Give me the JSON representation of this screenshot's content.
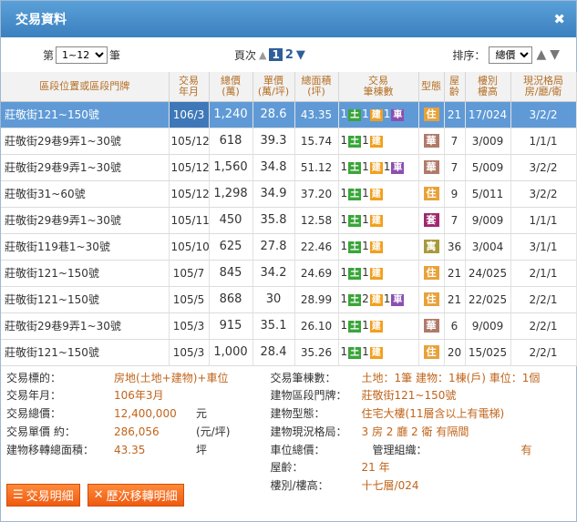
{
  "window": {
    "title": "交易資料",
    "close_glyph": "✖"
  },
  "toolbar": {
    "range_prefix": "第",
    "range_value": "1~12",
    "range_suffix": "筆",
    "page_label": "頁次",
    "current_page": "1",
    "next_page": "2",
    "sort_label": "排序：",
    "sort_value": "總價"
  },
  "table": {
    "headers": [
      "區段位置或區段門牌",
      "交易\n年月",
      "總價\n(萬)",
      "單價\n(萬/坪)",
      "總面積\n(坪)",
      "交易\n筆棟數",
      "型態",
      "屋\n齡",
      "樓別\n樓高",
      "現況格局\n房/廳/衛"
    ],
    "rows": [
      {
        "addr": "莊敬街121~150號",
        "date": "106/3",
        "total": "1,240",
        "unit": "28.6",
        "area": "43.35",
        "land": "1",
        "bld_n": "1",
        "car_n": "1",
        "has_car": true,
        "type": "住",
        "type_color": "zhu",
        "age": "21",
        "floor": "17/024",
        "layout": "3/2/2",
        "selected": true
      },
      {
        "addr": "莊敬街29巷9弄1~30號",
        "date": "105/12",
        "total": "618",
        "unit": "39.3",
        "area": "15.74",
        "land": "1",
        "bld_n": "1",
        "car_n": "",
        "has_car": false,
        "type": "華",
        "type_color": "hua",
        "age": "7",
        "floor": "3/009",
        "layout": "1/1/1"
      },
      {
        "addr": "莊敬街29巷9弄1~30號",
        "date": "105/12",
        "total": "1,560",
        "unit": "34.8",
        "area": "51.12",
        "land": "1",
        "bld_n": "1",
        "car_n": "1",
        "has_car": true,
        "type": "華",
        "type_color": "hua",
        "age": "7",
        "floor": "5/009",
        "layout": "3/2/2"
      },
      {
        "addr": "莊敬街31~60號",
        "date": "105/12",
        "total": "1,298",
        "unit": "34.9",
        "area": "37.20",
        "land": "1",
        "bld_n": "1",
        "car_n": "",
        "has_car": false,
        "type": "住",
        "type_color": "zhu",
        "age": "9",
        "floor": "5/011",
        "layout": "3/2/2"
      },
      {
        "addr": "莊敬街29巷9弄1~30號",
        "date": "105/11",
        "total": "450",
        "unit": "35.8",
        "area": "12.58",
        "land": "1",
        "bld_n": "1",
        "car_n": "",
        "has_car": false,
        "type": "套",
        "type_color": "tao",
        "age": "7",
        "floor": "9/009",
        "layout": "1/1/1"
      },
      {
        "addr": "莊敬街119巷1~30號",
        "date": "105/10",
        "total": "625",
        "unit": "27.8",
        "area": "22.46",
        "land": "1",
        "bld_n": "1",
        "car_n": "",
        "has_car": false,
        "type": "寓",
        "type_color": "yu",
        "age": "36",
        "floor": "3/004",
        "layout": "3/1/1"
      },
      {
        "addr": "莊敬街121~150號",
        "date": "105/7",
        "total": "845",
        "unit": "34.2",
        "area": "24.69",
        "land": "1",
        "bld_n": "1",
        "car_n": "",
        "has_car": false,
        "type": "住",
        "type_color": "zhu",
        "age": "21",
        "floor": "24/025",
        "layout": "2/1/1"
      },
      {
        "addr": "莊敬街121~150號",
        "date": "105/5",
        "total": "868",
        "unit": "30",
        "area": "28.99",
        "land": "1",
        "bld_n": "2",
        "car_n": "1",
        "has_car": true,
        "type": "住",
        "type_color": "zhu",
        "age": "21",
        "floor": "22/025",
        "layout": "2/2/1"
      },
      {
        "addr": "莊敬街29巷9弄1~30號",
        "date": "105/3",
        "total": "915",
        "unit": "35.1",
        "area": "26.10",
        "land": "1",
        "bld_n": "1",
        "car_n": "",
        "has_car": false,
        "type": "華",
        "type_color": "hua",
        "age": "6",
        "floor": "9/009",
        "layout": "2/2/1"
      },
      {
        "addr": "莊敬街121~150號",
        "date": "105/3",
        "total": "1,000",
        "unit": "28.4",
        "area": "35.26",
        "land": "1",
        "bld_n": "1",
        "car_n": "",
        "has_car": false,
        "type": "住",
        "type_color": "zhu",
        "age": "20",
        "floor": "15/025",
        "layout": "2/2/1"
      }
    ],
    "badge_land": "土",
    "badge_bld": "建",
    "badge_car": "車"
  },
  "detail": {
    "left": [
      {
        "label": "交易標的：",
        "value": "房地(土地+建物)+車位",
        "unit": ""
      },
      {
        "label": "交易年月：",
        "value": "106年3月",
        "unit": ""
      },
      {
        "label": "交易總價：",
        "value": "12,400,000",
        "unit": "元"
      },
      {
        "label": "交易單價 約：",
        "value": "286,056",
        "unit": "(元/坪)"
      },
      {
        "label": "建物移轉總面積：",
        "value": "43.35",
        "unit": "坪"
      }
    ],
    "right": [
      {
        "label": "交易筆棟數：",
        "value": "土地：1筆 建物：1棟(戶) 車位：1個",
        "unit": ""
      },
      {
        "label": "建物區段門牌：",
        "value": "莊敬街121~150號",
        "unit": ""
      },
      {
        "label": "建物型態：",
        "value": "住宅大樓(11層含以上有電梯)",
        "unit": ""
      },
      {
        "label": "建物現況格局：",
        "value": "3 房 2 廳 2 衛 有隔間",
        "unit": ""
      },
      {
        "label": "車位總價：",
        "value": "管理組織：",
        "unit": "有"
      },
      {
        "label": "屋齡：",
        "value": "21 年",
        "unit": ""
      },
      {
        "label": "樓別/樓高：",
        "value": "十七層/024",
        "unit": ""
      }
    ],
    "btn_detail": "交易明細",
    "btn_history": "歷次移轉明細"
  },
  "colors": {
    "accent": "#3b80bf",
    "selected_row": "#5f9ad6",
    "value_orange": "#c0641a"
  }
}
